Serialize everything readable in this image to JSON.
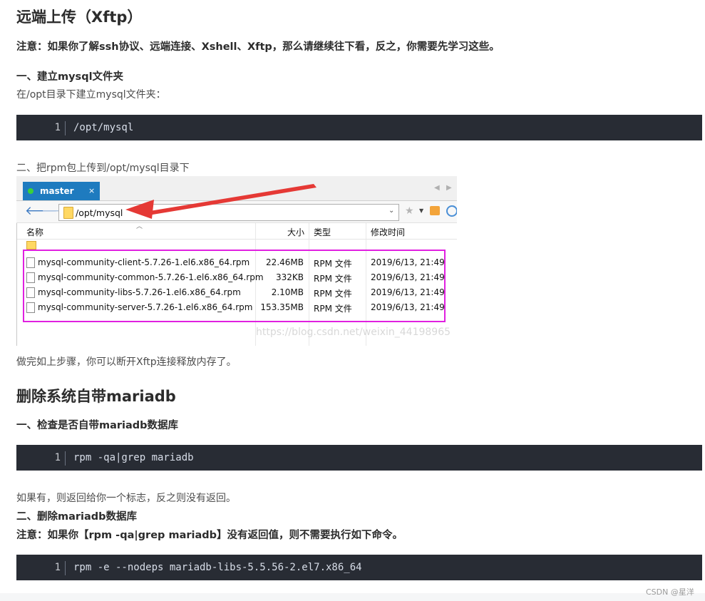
{
  "sections": {
    "upload_title": "远端上传（Xftp）",
    "note1": "注意：如果你了解ssh协议、远端连接、Xshell、Xftp，那么请继续往下看，反之，你需要先学习这些。",
    "step1_title": "一、建立mysql文件夹",
    "step1_text": "在/opt目录下建立mysql文件夹：",
    "code1": {
      "line": "1",
      "text": "/opt/mysql"
    },
    "step2_text": "二、把rpm包上传到/opt/mysql目录下",
    "after_shot_text": "做完如上步骤，你可以断开Xftp连接释放内存了。",
    "remove_title": "删除系统自带mariadb",
    "check_title": "一、检查是否自带mariadb数据库",
    "code2": {
      "line": "1",
      "text": "rpm -qa|grep mariadb"
    },
    "return_text": "如果有，则返回给你一个标志，反之则没有返回。",
    "delete_title": "二、删除mariadb数据库",
    "note2": "注意：如果你【rpm -qa|grep mariadb】没有返回值，则不需要执行如下命令。",
    "code3": {
      "line": "1",
      "text": "rpm -e --nodeps mariadb-libs-5.5.56-2.el7.x86_64"
    },
    "footer": "CSDN @星洋"
  },
  "xftp": {
    "tab_label": "master",
    "tab_close": "×",
    "address": "/opt/mysql",
    "columns": {
      "name": "名称",
      "size": "大小",
      "type": "类型",
      "modified": "修改时间"
    },
    "files": [
      {
        "name": "mysql-community-client-5.7.26-1.el6.x86_64.rpm",
        "size": "22.46MB",
        "type": "RPM 文件",
        "modified": "2019/6/13, 21:49"
      },
      {
        "name": "mysql-community-common-5.7.26-1.el6.x86_64.rpm",
        "size": "332KB",
        "type": "RPM 文件",
        "modified": "2019/6/13, 21:49"
      },
      {
        "name": "mysql-community-libs-5.7.26-1.el6.x86_64.rpm",
        "size": "2.10MB",
        "type": "RPM 文件",
        "modified": "2019/6/13, 21:49"
      },
      {
        "name": "mysql-community-server-5.7.26-1.el6.x86_64.rpm",
        "size": "153.35MB",
        "type": "RPM 文件",
        "modified": "2019/6/13, 21:49"
      }
    ],
    "watermark": "https://blog.csdn.net/weixin_44198965",
    "highlight_color": "#e020e0",
    "arrow_color": "#e53935",
    "tab_color": "#1e7bbf"
  }
}
